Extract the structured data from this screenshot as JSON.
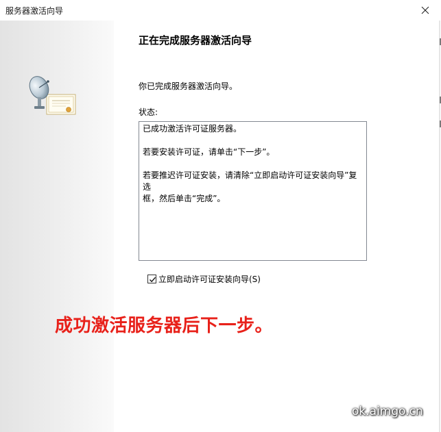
{
  "window": {
    "title": "服务器激活向导"
  },
  "wizard": {
    "heading": "正在完成服务器激活向导",
    "intro": "你已完成服务器激活向导。",
    "status_label": "状态:",
    "status_lines": [
      "已成功激活许可证服务器。",
      "",
      "若要安装许可证，请单击“下一步”。",
      "",
      "若要推迟许可证安装，请清除“立即启动许可证安装向导”复选",
      "框，然后单击“完成”。"
    ],
    "checkbox": {
      "label": "立即启动许可证安装向导(S)",
      "checked": true
    }
  },
  "annotation": {
    "text": "成功激活服务器后下一步。",
    "color": "#e8211a"
  },
  "watermark": {
    "text": "ok.aimgo.cn"
  },
  "icons": {
    "wizard_icon": "satellite-dish-certificate-icon",
    "close": "close-icon"
  }
}
